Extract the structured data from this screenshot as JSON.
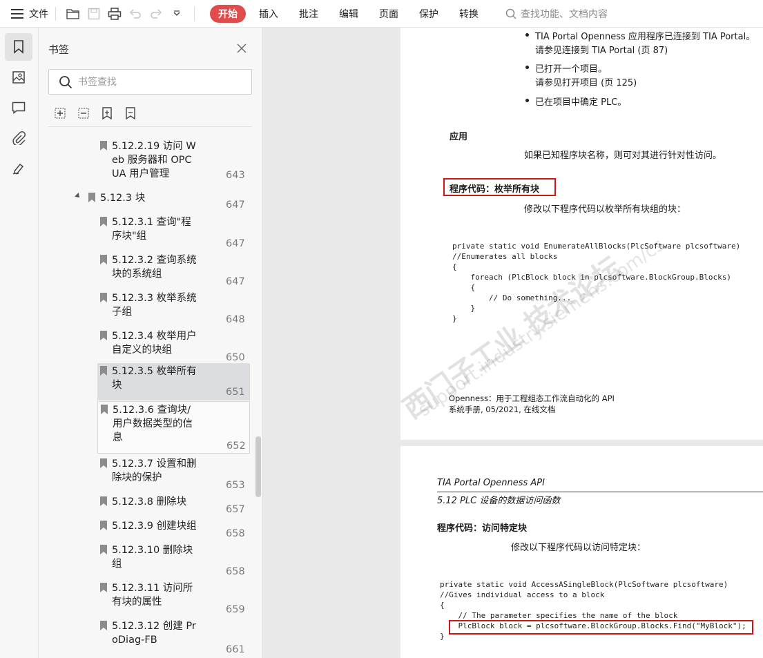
{
  "toolbar": {
    "menu_label": "文件",
    "tabs": [
      "开始",
      "插入",
      "批注",
      "编辑",
      "页面",
      "保护",
      "转换"
    ],
    "search_placeholder": "查找功能、文档内容"
  },
  "panel": {
    "title": "书签",
    "search_placeholder": "书签查找"
  },
  "bookmarks": [
    {
      "label": "5.12.2.19 访问 W\neb 服务器和 OPC\nUA 用户管理",
      "page": "643"
    },
    {
      "label": "5.12.3 块",
      "page": "647"
    },
    {
      "label": "5.12.3.1 查询\"程\n序块\"组",
      "page": "647"
    },
    {
      "label": "5.12.3.2 查询系统\n块的系统组",
      "page": "647"
    },
    {
      "label": "5.12.3.3 枚举系统\n子组",
      "page": "648"
    },
    {
      "label": "5.12.3.4 枚举用户\n自定义的块组",
      "page": "650"
    },
    {
      "label": "5.12.3.5 枚举所有\n块",
      "page": "651"
    },
    {
      "label": "5.12.3.6 查询块/\n用户数据类型的信\n息",
      "page": "652"
    },
    {
      "label": "5.12.3.7 设置和删\n除块的保护",
      "page": "653"
    },
    {
      "label": "5.12.3.8 删除块",
      "page": "657"
    },
    {
      "label": "5.12.3.9 创建块组",
      "page": "658"
    },
    {
      "label": "5.12.3.10 删除块\n组",
      "page": "658"
    },
    {
      "label": "5.12.3.11 访问所\n有块的属性",
      "page": "659"
    },
    {
      "label": "5.12.3.12 创建 Pr\noDiag-FB",
      "page": "661"
    }
  ],
  "page1": {
    "bullets": [
      "TIA Portal Openness 应用程序已连接到 TIA Portal。",
      "请参见连接到 TIA Portal (页 87)",
      "已打开一个项目。",
      "请参见打开项目 (页 125)",
      "已在项目中确定 PLC。"
    ],
    "heading_apply": "应用",
    "apply_text": "如果已知程序块名称，则可对其进行针对性访问。",
    "heading_code": "程序代码：枚举所有块",
    "code_intro": "修改以下程序代码以枚举所有块组的块：",
    "code": [
      "private static void EnumerateAllBlocks(PlcSoftware plcsoftware)",
      "//Enumerates all blocks",
      "{",
      "    foreach (PlcBlock block in plcsoftware.BlockGroup.Blocks)",
      "    {",
      "        // Do something...",
      "    }",
      "}"
    ],
    "footer1": "Openness：用于工程组态工作流自动化的 API",
    "footer2": "系统手册, 05/2021, 在线文档",
    "watermark1": "西门子工业 技术论坛",
    "watermark2": "support.industry.siemens.com/cs"
  },
  "page2": {
    "header1": "TIA Portal Openness API",
    "header2": "5.12 PLC 设备的数据访问函数",
    "heading": "程序代码：访问特定块",
    "intro": "修改以下程序代码以访问特定块：",
    "code": [
      "private static void AccessASingleBlock(PlcSoftware plcsoftware)",
      "//Gives individual access to a block",
      "{",
      "    // The parameter specifies the name of the block",
      "    PlcBlock block = plcsoftware.BlockGroup.Blocks.Find(\"MyBlock\");",
      "}"
    ]
  },
  "colors": {
    "accent": "#e04c4c",
    "highlight_box": "#d01515",
    "selected_bookmark": "#dcdde1"
  }
}
